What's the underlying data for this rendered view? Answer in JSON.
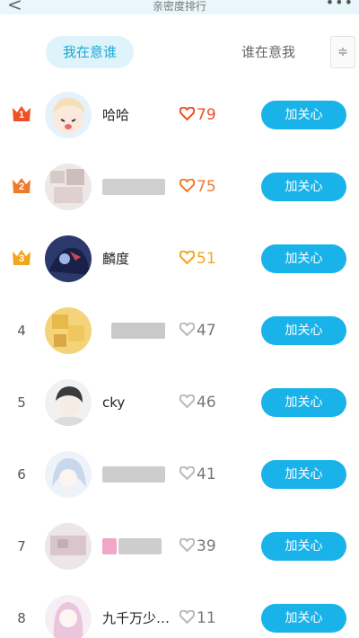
{
  "header": {
    "back_glyph": "<",
    "title": "亲密度排行",
    "more_glyph": "•••"
  },
  "tabs": {
    "active_label": "我在意谁",
    "inactive_label": "谁在意我",
    "menu_icon": "≑"
  },
  "colors": {
    "accent": "#19b3ea",
    "rank1": "#ef4f24",
    "rank2": "#f07a2c",
    "rank3": "#f2a51f",
    "grey_heart": "#b9b9b9"
  },
  "rows": [
    {
      "rank": "1",
      "crown": true,
      "name": "哈哈",
      "score": "79",
      "button": "加关心"
    },
    {
      "rank": "2",
      "crown": true,
      "name": "",
      "score": "75",
      "button": "加关心"
    },
    {
      "rank": "3",
      "crown": true,
      "name": "麟度",
      "score": "51",
      "button": "加关心"
    },
    {
      "rank": "4",
      "crown": false,
      "name": "",
      "score": "47",
      "button": "加关心"
    },
    {
      "rank": "5",
      "crown": false,
      "name": "cky",
      "score": "46",
      "button": "加关心"
    },
    {
      "rank": "6",
      "crown": false,
      "name": "",
      "score": "41",
      "button": "加关心"
    },
    {
      "rank": "7",
      "crown": false,
      "name": "",
      "score": "39",
      "button": "加关心"
    },
    {
      "rank": "8",
      "crown": false,
      "name": "九千万少…",
      "score": "11",
      "button": "加关心"
    }
  ]
}
